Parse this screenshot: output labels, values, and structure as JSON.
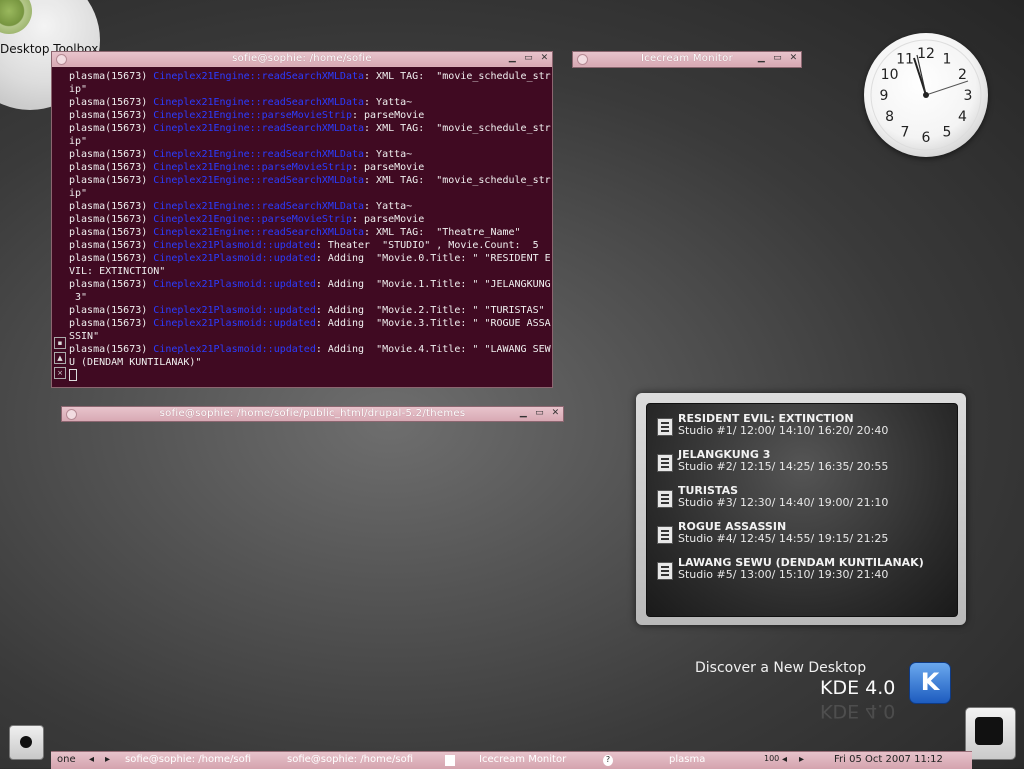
{
  "desktop": {
    "toolbox_label": "Desktop Toolbox"
  },
  "terminal_main": {
    "title": "sofie@sophie: /home/sofie",
    "buttons": [
      "minimize",
      "maximize",
      "close"
    ],
    "lines": [
      [
        {
          "t": "plasma(15673) "
        },
        {
          "t": "Cineplex21Engine::readSearchXMLData",
          "fn": true
        },
        {
          "t": ": XML TAG:  \"movie_schedule_str"
        }
      ],
      [
        {
          "t": "ip\""
        }
      ],
      [
        {
          "t": "plasma(15673) "
        },
        {
          "t": "Cineplex21Engine::readSearchXMLData",
          "fn": true
        },
        {
          "t": ": Yatta~"
        }
      ],
      [
        {
          "t": "plasma(15673) "
        },
        {
          "t": "Cineplex21Engine::parseMovieStrip",
          "fn": true
        },
        {
          "t": ": parseMovie"
        }
      ],
      [
        {
          "t": "plasma(15673) "
        },
        {
          "t": "Cineplex21Engine::readSearchXMLData",
          "fn": true
        },
        {
          "t": ": XML TAG:  \"movie_schedule_str"
        }
      ],
      [
        {
          "t": "ip\""
        }
      ],
      [
        {
          "t": "plasma(15673) "
        },
        {
          "t": "Cineplex21Engine::readSearchXMLData",
          "fn": true
        },
        {
          "t": ": Yatta~"
        }
      ],
      [
        {
          "t": "plasma(15673) "
        },
        {
          "t": "Cineplex21Engine::parseMovieStrip",
          "fn": true
        },
        {
          "t": ": parseMovie"
        }
      ],
      [
        {
          "t": "plasma(15673) "
        },
        {
          "t": "Cineplex21Engine::readSearchXMLData",
          "fn": true
        },
        {
          "t": ": XML TAG:  \"movie_schedule_str"
        }
      ],
      [
        {
          "t": "ip\""
        }
      ],
      [
        {
          "t": "plasma(15673) "
        },
        {
          "t": "Cineplex21Engine::readSearchXMLData",
          "fn": true
        },
        {
          "t": ": Yatta~"
        }
      ],
      [
        {
          "t": "plasma(15673) "
        },
        {
          "t": "Cineplex21Engine::parseMovieStrip",
          "fn": true
        },
        {
          "t": ": parseMovie"
        }
      ],
      [
        {
          "t": "plasma(15673) "
        },
        {
          "t": "Cineplex21Engine::readSearchXMLData",
          "fn": true
        },
        {
          "t": ": XML TAG:  \"Theatre_Name\""
        }
      ],
      [
        {
          "t": "plasma(15673) "
        },
        {
          "t": "Cineplex21Plasmoid::updated",
          "fn": true
        },
        {
          "t": ": Theater  \"STUDIO\" , Movie.Count:  5"
        }
      ],
      [
        {
          "t": "plasma(15673) "
        },
        {
          "t": "Cineplex21Plasmoid::updated",
          "fn": true
        },
        {
          "t": ": Adding  \"Movie.0.Title: \" \"RESIDENT E"
        }
      ],
      [
        {
          "t": "VIL: EXTINCTION\""
        }
      ],
      [
        {
          "t": "plasma(15673) "
        },
        {
          "t": "Cineplex21Plasmoid::updated",
          "fn": true
        },
        {
          "t": ": Adding  \"Movie.1.Title: \" \"JELANGKUNG"
        }
      ],
      [
        {
          "t": " 3\""
        }
      ],
      [
        {
          "t": "plasma(15673) "
        },
        {
          "t": "Cineplex21Plasmoid::updated",
          "fn": true
        },
        {
          "t": ": Adding  \"Movie.2.Title: \" \"TURISTAS\""
        }
      ],
      [
        {
          "t": "plasma(15673) "
        },
        {
          "t": "Cineplex21Plasmoid::updated",
          "fn": true
        },
        {
          "t": ": Adding  \"Movie.3.Title: \" \"ROGUE ASSA"
        }
      ],
      [
        {
          "t": "SSIN\""
        }
      ],
      [
        {
          "t": "plasma(15673) "
        },
        {
          "t": "Cineplex21Plasmoid::updated",
          "fn": true
        },
        {
          "t": ": Adding  \"Movie.4.Title: \" \"LAWANG SEW"
        }
      ],
      [
        {
          "t": "U (DENDAM KUNTILANAK)\""
        }
      ]
    ]
  },
  "terminal_second": {
    "title": "sofie@sophie: /home/sofie/public_html/drupal-5.2/themes"
  },
  "icecream_window": {
    "title": "Icecream Monitor"
  },
  "clock": {
    "numbers": [
      "12",
      "1",
      "2",
      "3",
      "4",
      "5",
      "6",
      "7",
      "8",
      "9",
      "10",
      "11"
    ]
  },
  "cinema_widget": {
    "movies": [
      {
        "title": "RESIDENT EVIL: EXTINCTION",
        "schedule": "Studio #1/ 12:00/ 14:10/ 16:20/ 20:40"
      },
      {
        "title": "JELANGKUNG 3",
        "schedule": "Studio #2/ 12:15/ 14:25/ 16:35/ 20:55"
      },
      {
        "title": "TURISTAS",
        "schedule": "Studio #3/ 12:30/ 14:40/ 19:00/ 21:10"
      },
      {
        "title": "ROGUE ASSASSIN",
        "schedule": "Studio #4/ 12:45/ 14:55/ 19:15/ 21:25"
      },
      {
        "title": "LAWANG SEWU (DENDAM KUNTILANAK)",
        "schedule": "Studio #5/ 13:00/ 15:10/ 19:30/ 21:40"
      }
    ]
  },
  "branding": {
    "tagline": "Discover a New Desktop",
    "version": "KDE 4.0",
    "logo_letter": "K"
  },
  "taskbar": {
    "desktop_name": "one",
    "tasks": [
      "sofie@sophie: /home/sofi",
      "sofie@sophie: /home/sofi",
      "Icecream Monitor",
      "plasma"
    ],
    "pager_value": "100",
    "datetime": "Fri 05 Oct 2007 11:12"
  }
}
